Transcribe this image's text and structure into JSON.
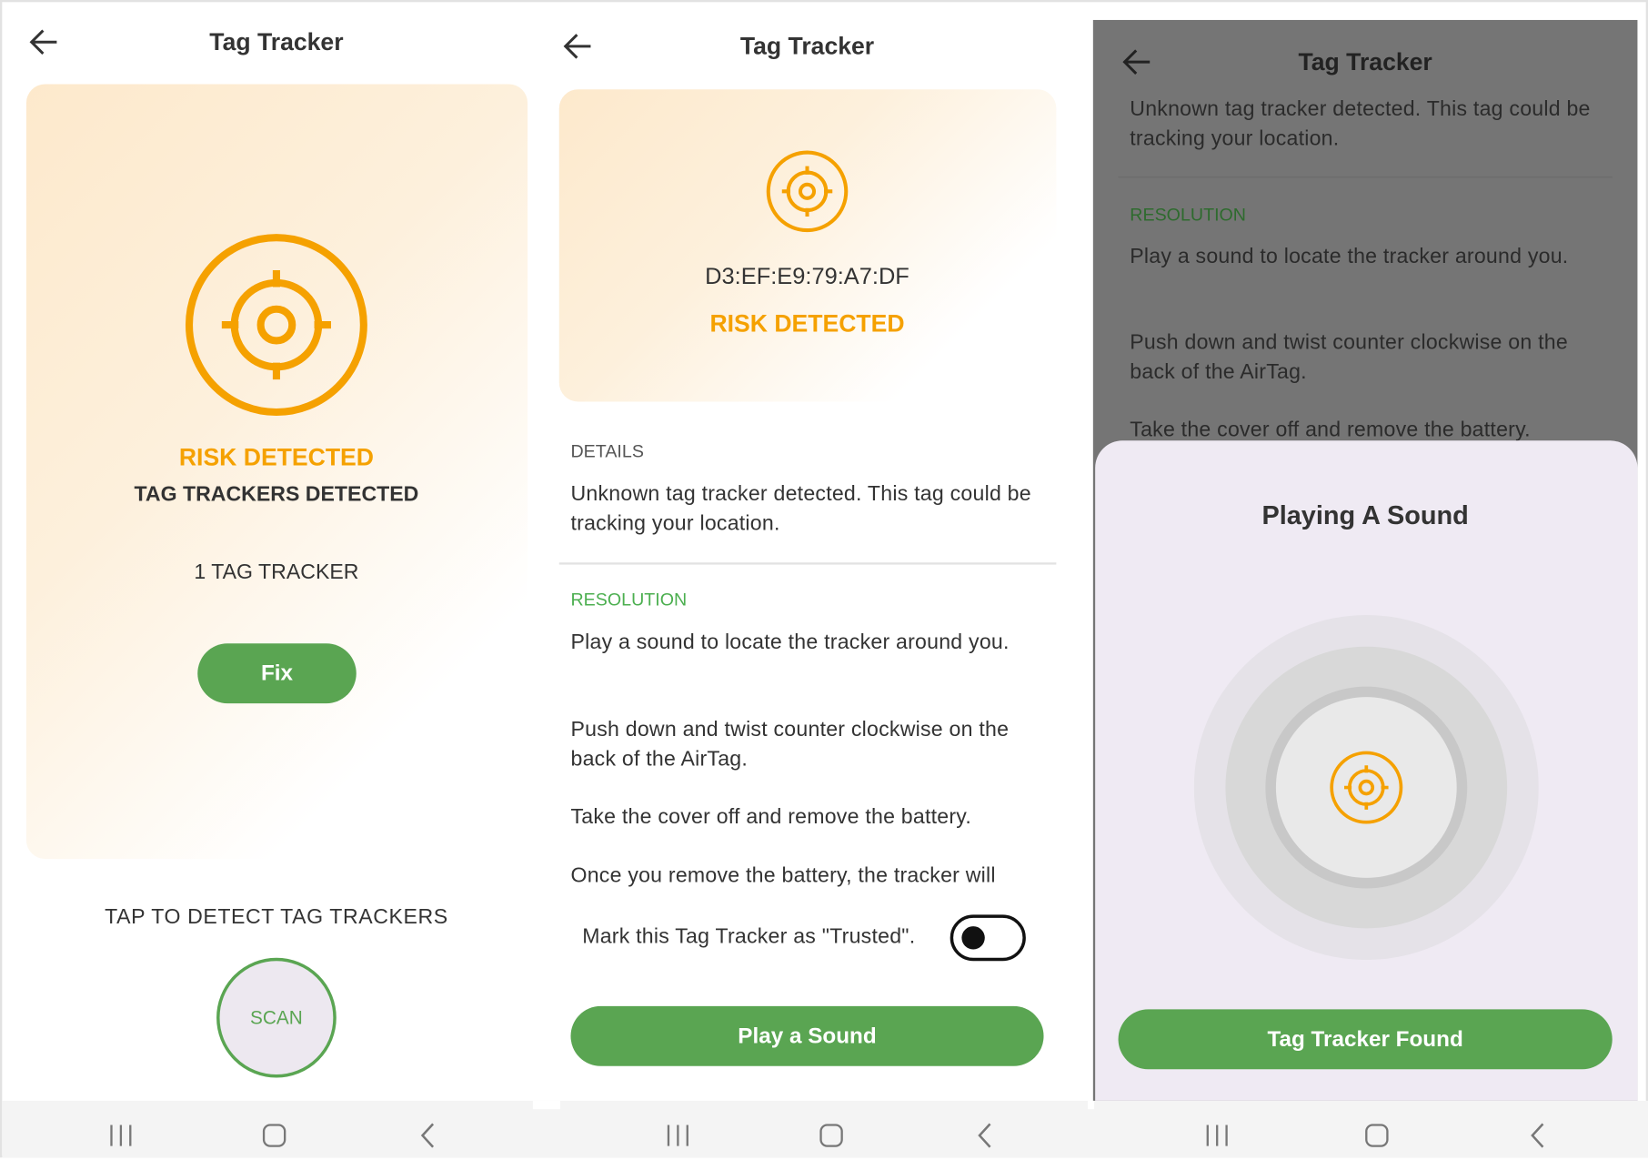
{
  "screens": [
    {
      "header": {
        "title": "Tag Tracker",
        "back_icon": "arrow-left-icon"
      },
      "status": {
        "risk": "RISK DETECTED",
        "subtitle": "TAG TRACKERS DETECTED",
        "count": "1 TAG TRACKER"
      },
      "fix_label": "Fix",
      "scan_prompt": "TAP TO DETECT TAG TRACKERS",
      "scan_label": "SCAN"
    },
    {
      "header": {
        "title": "Tag Tracker"
      },
      "device_id": "D3:EF:E9:79:A7:DF",
      "risk": "RISK DETECTED",
      "details_heading": "DETAILS",
      "details_text": "Unknown tag tracker detected. This tag could be tracking your location.",
      "resolution_heading": "RESOLUTION",
      "steps": [
        "Play a sound to locate the tracker around you.",
        "Push down and twist counter clockwise on the back of the AirTag.",
        "Take the cover off and remove the battery.",
        "Once you remove the battery, the tracker will"
      ],
      "trusted_label": "Mark this Tag Tracker as \"Trusted\".",
      "trusted_toggle_on": false,
      "play_sound_label": "Play a Sound"
    },
    {
      "header": {
        "title": "Tag Tracker"
      },
      "details_text": "Unknown tag tracker detected. This tag could be tracking your location.",
      "resolution_heading": "RESOLUTION",
      "steps": [
        "Play a sound to locate the tracker around you.",
        "Push down and twist counter clockwise on the back of the AirTag.",
        "Take the cover off and remove the battery."
      ],
      "sheet_title": "Playing A Sound",
      "found_label": "Tag Tracker Found"
    }
  ],
  "nav_icons": [
    "recent-apps-icon",
    "home-icon",
    "back-icon"
  ],
  "colors": {
    "accent_orange": "#f5a100",
    "green": "#5aa552",
    "overlay": "#757575"
  }
}
